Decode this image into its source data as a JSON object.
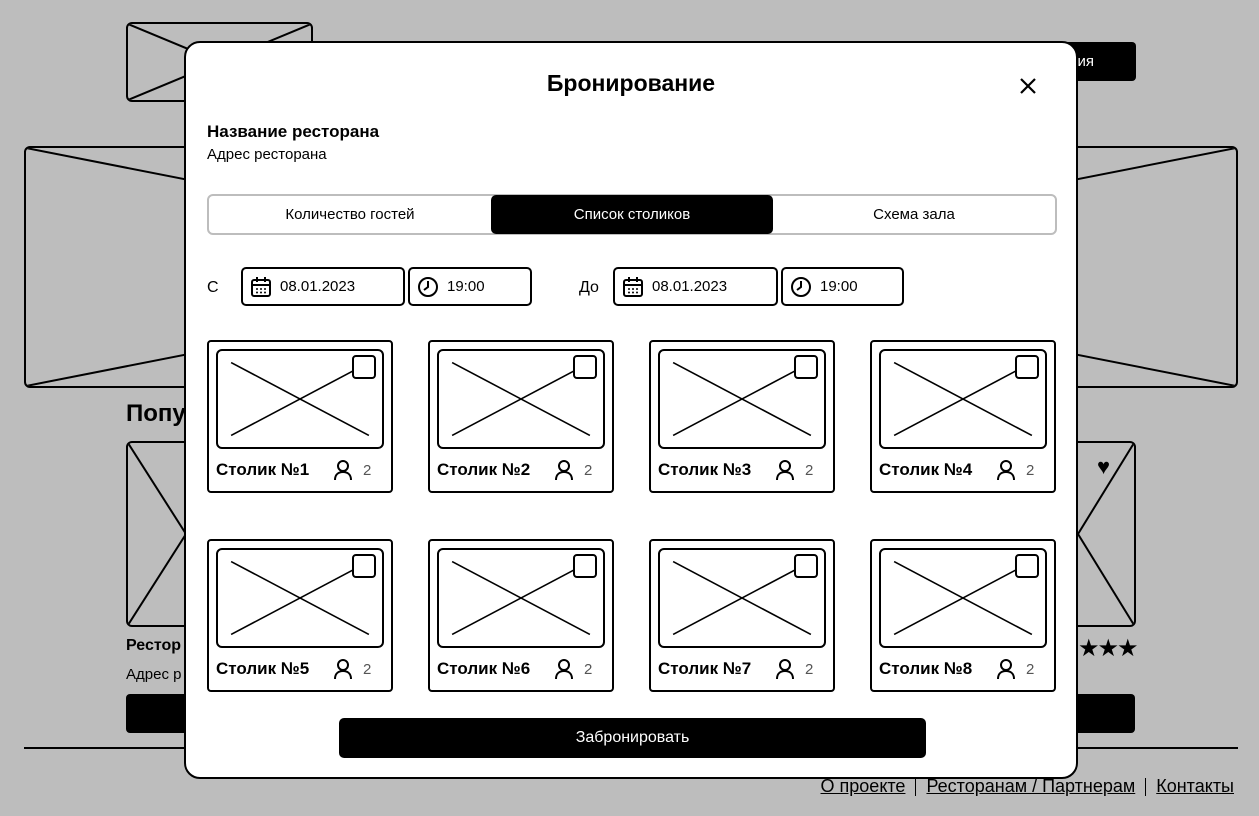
{
  "background": {
    "header_button_label": "ия",
    "section_title": "Попу",
    "card_title": "Рестор",
    "card_address": "Адрес р",
    "rating_stars": "★★★",
    "favorite_icon": "heart-icon"
  },
  "footer": {
    "links": [
      "О проекте",
      "Ресторанам / Партнерам",
      "Контакты"
    ]
  },
  "modal": {
    "title": "Бронирование",
    "close_icon": "close-icon",
    "restaurant_name": "Название ресторана",
    "restaurant_address": "Адрес ресторана",
    "tabs": [
      {
        "label": "Количество гостей",
        "active": false
      },
      {
        "label": "Список столиков",
        "active": true
      },
      {
        "label": "Схема зала",
        "active": false
      }
    ],
    "from_label": "С",
    "to_label": "До",
    "from_date": "08.01.2023",
    "from_time": "19:00",
    "to_date": "08.01.2023",
    "to_time": "19:00",
    "tables": [
      {
        "name": "Столик №1",
        "capacity": "2"
      },
      {
        "name": "Столик №2",
        "capacity": "2"
      },
      {
        "name": "Столик №3",
        "capacity": "2"
      },
      {
        "name": "Столик №4",
        "capacity": "2"
      },
      {
        "name": "Столик №5",
        "capacity": "2"
      },
      {
        "name": "Столик №6",
        "capacity": "2"
      },
      {
        "name": "Столик №7",
        "capacity": "2"
      },
      {
        "name": "Столик №8",
        "capacity": "2"
      }
    ],
    "book_button": "Забронировать"
  }
}
